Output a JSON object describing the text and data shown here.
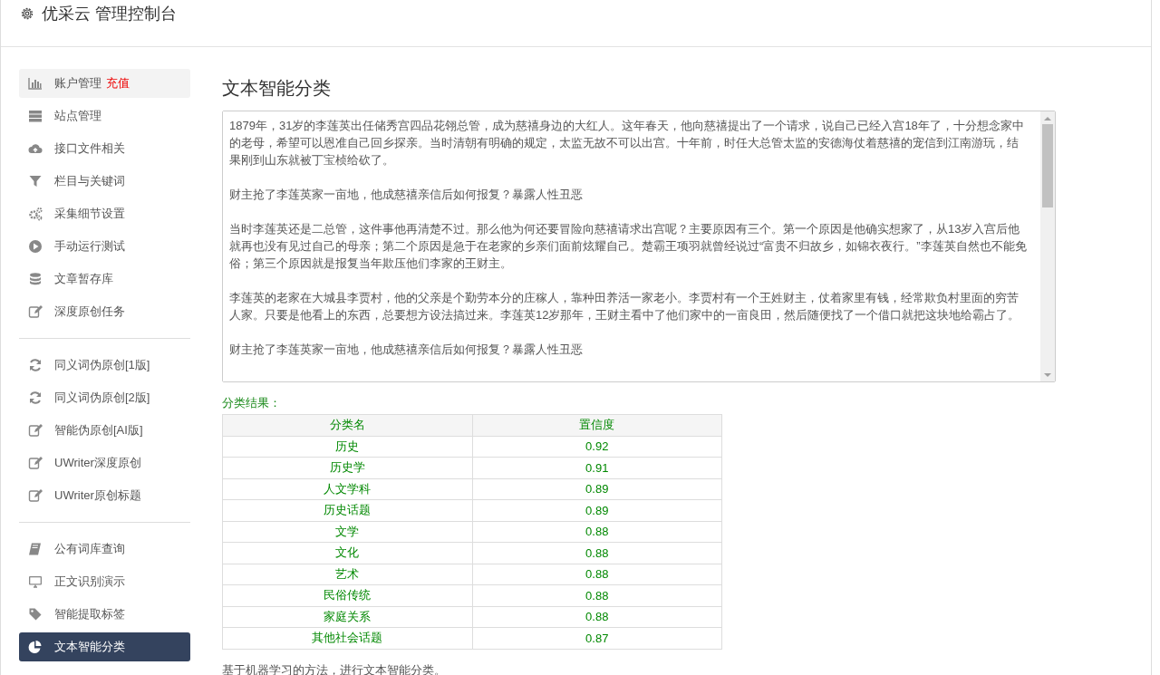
{
  "header": {
    "title": "优采云 管理控制台"
  },
  "sidebar": {
    "groups": [
      {
        "items": [
          {
            "label": "账户管理",
            "badge": "充值",
            "highlighted": true,
            "selected": false
          },
          {
            "label": "站点管理",
            "highlighted": false,
            "selected": false
          },
          {
            "label": "接口文件相关",
            "highlighted": false,
            "selected": false
          },
          {
            "label": "栏目与关键词",
            "highlighted": false,
            "selected": false
          },
          {
            "label": "采集细节设置",
            "highlighted": false,
            "selected": false
          },
          {
            "label": "手动运行测试",
            "highlighted": false,
            "selected": false
          },
          {
            "label": "文章暂存库",
            "highlighted": false,
            "selected": false
          },
          {
            "label": "深度原创任务",
            "highlighted": false,
            "selected": false
          }
        ]
      },
      {
        "items": [
          {
            "label": "同义词伪原创[1版]",
            "highlighted": false,
            "selected": false
          },
          {
            "label": "同义词伪原创[2版]",
            "highlighted": false,
            "selected": false
          },
          {
            "label": "智能伪原创[AI版]",
            "highlighted": false,
            "selected": false
          },
          {
            "label": "UWriter深度原创",
            "highlighted": false,
            "selected": false
          },
          {
            "label": "UWriter原创标题",
            "highlighted": false,
            "selected": false
          }
        ]
      },
      {
        "items": [
          {
            "label": "公有词库查询",
            "highlighted": false,
            "selected": false
          },
          {
            "label": "正文识别演示",
            "highlighted": false,
            "selected": false
          },
          {
            "label": "智能提取标签",
            "highlighted": false,
            "selected": false
          },
          {
            "label": "文本智能分类",
            "highlighted": false,
            "selected": true
          }
        ]
      }
    ]
  },
  "main": {
    "title": "文本智能分类",
    "article": {
      "paragraphs": [
        "1879年，31岁的李莲英出任储秀宫四品花翎总管，成为慈禧身边的大红人。这年春天，他向慈禧提出了一个请求，说自己已经入宫18年了，十分想念家中的老母，希望可以恩准自己回乡探亲。当时清朝有明确的规定，太监无故不可以出宫。十年前，时任大总管太监的安德海仗着慈禧的宠信到江南游玩，结果刚到山东就被丁宝桢给砍了。",
        "财主抢了李莲英家一亩地，他成慈禧亲信后如何报复？暴露人性丑恶",
        "当时李莲英还是二总管，这件事他再清楚不过。那么他为何还要冒险向慈禧请求出宫呢？主要原因有三个。第一个原因是他确实想家了，从13岁入宫后他就再也没有见过自己的母亲；第二个原因是急于在老家的乡亲们面前炫耀自己。楚霸王项羽就曾经说过“富贵不归故乡，如锦衣夜行。”李莲英自然也不能免俗；第三个原因就是报复当年欺压他们李家的王财主。",
        "李莲英的老家在大城县李贾村，他的父亲是个勤劳本分的庄稼人，靠种田养活一家老小。李贾村有一个王姓财主，仗着家里有钱，经常欺负村里面的穷苦人家。只要是他看上的东西，总要想方设法搞过来。李莲英12岁那年，王财主看中了他们家中的一亩良田，然后随便找了一个借口就把这块地给霸占了。",
        "财主抢了李莲英家一亩地，他成慈禧亲信后如何报复？暴露人性丑恶"
      ]
    },
    "result_label": "分类结果：",
    "table": {
      "columns": [
        "分类名",
        "置信度"
      ],
      "rows": [
        [
          "历史",
          "0.92"
        ],
        [
          "历史学",
          "0.91"
        ],
        [
          "人文学科",
          "0.89"
        ],
        [
          "历史话题",
          "0.89"
        ],
        [
          "文学",
          "0.88"
        ],
        [
          "文化",
          "0.88"
        ],
        [
          "艺术",
          "0.88"
        ],
        [
          "民俗传统",
          "0.88"
        ],
        [
          "家庭关系",
          "0.88"
        ],
        [
          "其他社会话题",
          "0.87"
        ]
      ]
    },
    "footnote": "基于机器学习的方法，进行文本智能分类。"
  }
}
